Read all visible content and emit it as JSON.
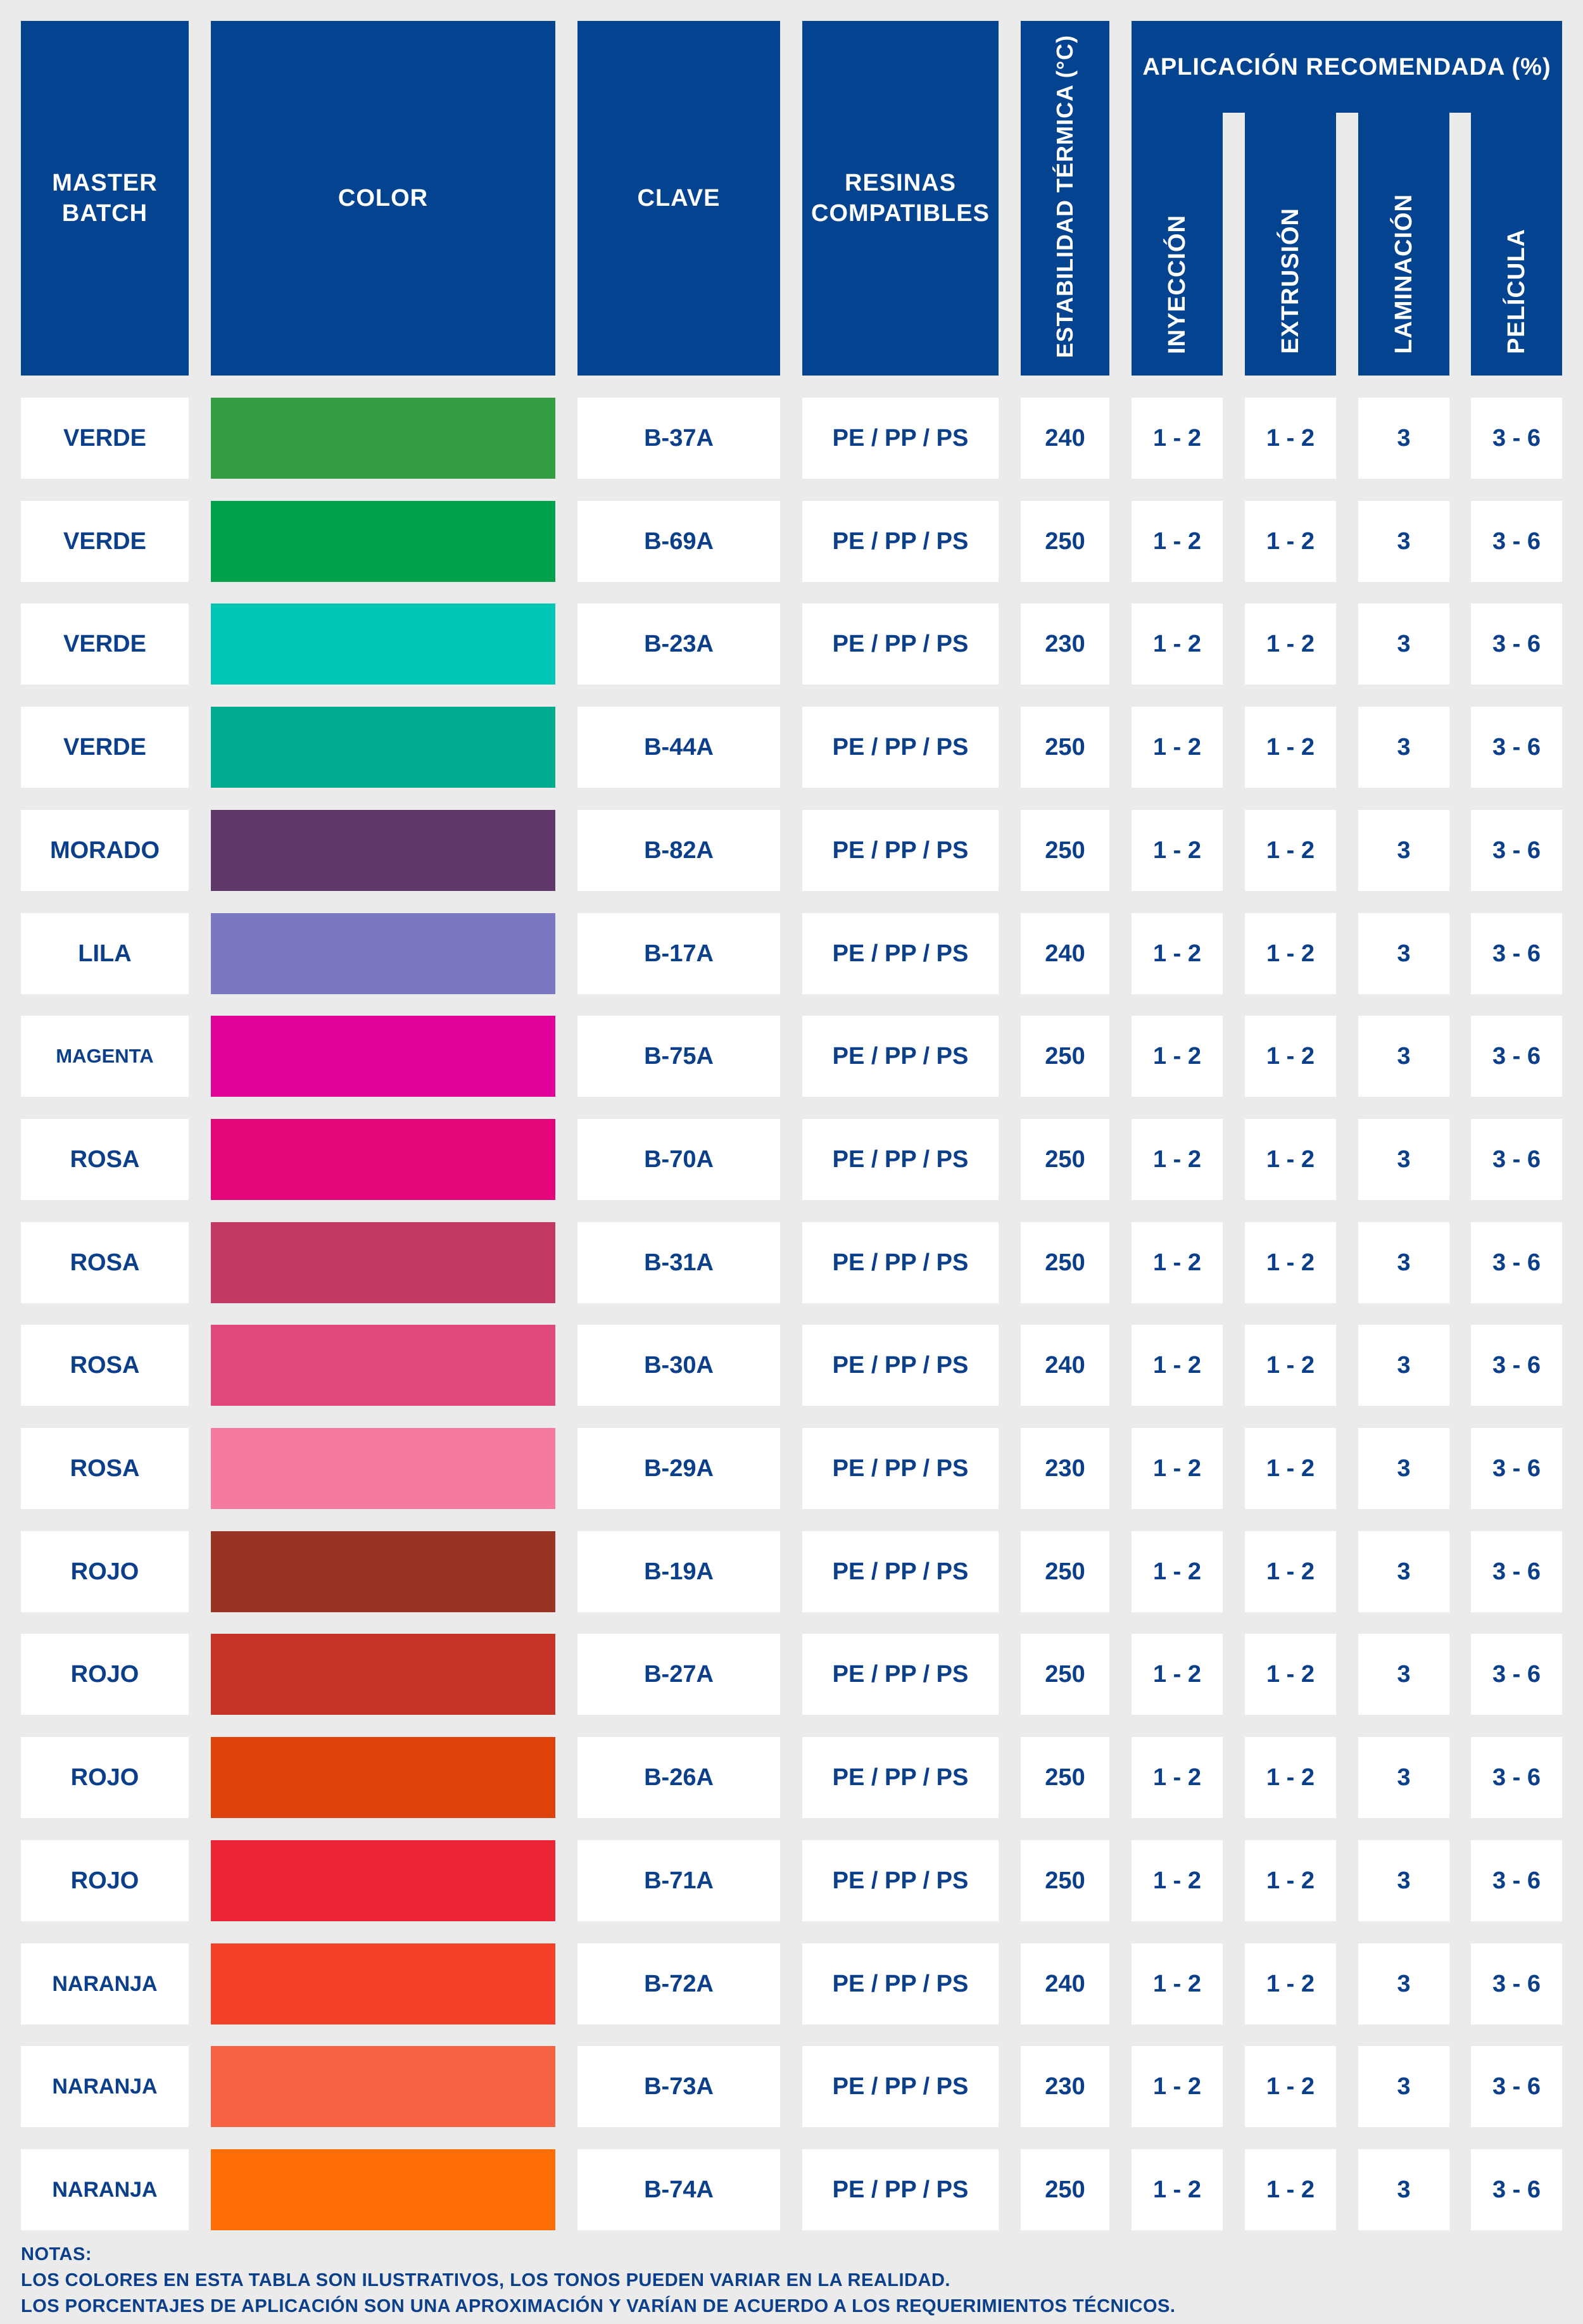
{
  "headers": {
    "master_batch": "MASTER\nBATCH",
    "color": "COLOR",
    "clave": "CLAVE",
    "resinas": "RESINAS\nCOMPATIBLES",
    "estabilidad": "ESTABILIDAD TÉRMICA (°C)",
    "aplicacion": "APLICACIÓN RECOMENDADA (%)",
    "inyeccion": "INYECCIÓN",
    "extrusion": "EXTRUSIÓN",
    "laminacion": "LAMINACIÓN",
    "pelicula": "PELÍCULA"
  },
  "colors": {
    "header_bg": "#03438f",
    "cell_text": "#0b3f8a",
    "page_bg": "#ebebeb"
  },
  "rows": [
    {
      "name": "VERDE",
      "swatch": "#339d41",
      "clave": "B-37A",
      "resinas": "PE / PP / PS",
      "estabilidad": "240",
      "inyeccion": "1 - 2",
      "extrusion": "1 - 2",
      "laminacion": "3",
      "pelicula": "3 - 6"
    },
    {
      "name": "VERDE",
      "swatch": "#00a14c",
      "clave": "B-69A",
      "resinas": "PE / PP / PS",
      "estabilidad": "250",
      "inyeccion": "1 - 2",
      "extrusion": "1 - 2",
      "laminacion": "3",
      "pelicula": "3 - 6"
    },
    {
      "name": "VERDE",
      "swatch": "#00c7b3",
      "clave": "B-23A",
      "resinas": "PE / PP / PS",
      "estabilidad": "230",
      "inyeccion": "1 - 2",
      "extrusion": "1 - 2",
      "laminacion": "3",
      "pelicula": "3 - 6"
    },
    {
      "name": "VERDE",
      "swatch": "#00ab8f",
      "clave": "B-44A",
      "resinas": "PE / PP / PS",
      "estabilidad": "250",
      "inyeccion": "1 - 2",
      "extrusion": "1 - 2",
      "laminacion": "3",
      "pelicula": "3 - 6"
    },
    {
      "name": "MORADO",
      "swatch": "#5f376b",
      "clave": "B-82A",
      "resinas": "PE / PP / PS",
      "estabilidad": "250",
      "inyeccion": "1 - 2",
      "extrusion": "1 - 2",
      "laminacion": "3",
      "pelicula": "3 - 6"
    },
    {
      "name": "LILA",
      "swatch": "#7a78c1",
      "clave": "B-17A",
      "resinas": "PE / PP / PS",
      "estabilidad": "240",
      "inyeccion": "1 - 2",
      "extrusion": "1 - 2",
      "laminacion": "3",
      "pelicula": "3 - 6"
    },
    {
      "name": "MAGENTA",
      "swatch": "#e1029a",
      "clave": "B-75A",
      "resinas": "PE / PP / PS",
      "estabilidad": "250",
      "inyeccion": "1 - 2",
      "extrusion": "1 - 2",
      "laminacion": "3",
      "pelicula": "3 - 6"
    },
    {
      "name": "ROSA",
      "swatch": "#e5057a",
      "clave": "B-70A",
      "resinas": "PE / PP / PS",
      "estabilidad": "250",
      "inyeccion": "1 - 2",
      "extrusion": "1 - 2",
      "laminacion": "3",
      "pelicula": "3 - 6"
    },
    {
      "name": "ROSA",
      "swatch": "#c33763",
      "clave": "B-31A",
      "resinas": "PE / PP / PS",
      "estabilidad": "250",
      "inyeccion": "1 - 2",
      "extrusion": "1 - 2",
      "laminacion": "3",
      "pelicula": "3 - 6"
    },
    {
      "name": "ROSA",
      "swatch": "#e0497e",
      "clave": "B-30A",
      "resinas": "PE / PP / PS",
      "estabilidad": "240",
      "inyeccion": "1 - 2",
      "extrusion": "1 - 2",
      "laminacion": "3",
      "pelicula": "3 - 6"
    },
    {
      "name": "ROSA",
      "swatch": "#f57a9e",
      "clave": "B-29A",
      "resinas": "PE / PP / PS",
      "estabilidad": "230",
      "inyeccion": "1 - 2",
      "extrusion": "1 - 2",
      "laminacion": "3",
      "pelicula": "3 - 6"
    },
    {
      "name": "ROJO",
      "swatch": "#993325",
      "clave": "B-19A",
      "resinas": "PE / PP / PS",
      "estabilidad": "250",
      "inyeccion": "1 - 2",
      "extrusion": "1 - 2",
      "laminacion": "3",
      "pelicula": "3 - 6"
    },
    {
      "name": "ROJO",
      "swatch": "#c53426",
      "clave": "B-27A",
      "resinas": "PE / PP / PS",
      "estabilidad": "250",
      "inyeccion": "1 - 2",
      "extrusion": "1 - 2",
      "laminacion": "3",
      "pelicula": "3 - 6"
    },
    {
      "name": "ROJO",
      "swatch": "#dc420a",
      "clave": "B-26A",
      "resinas": "PE / PP / PS",
      "estabilidad": "250",
      "inyeccion": "1 - 2",
      "extrusion": "1 - 2",
      "laminacion": "3",
      "pelicula": "3 - 6"
    },
    {
      "name": "ROJO",
      "swatch": "#ec2636",
      "clave": "B-71A",
      "resinas": "PE / PP / PS",
      "estabilidad": "250",
      "inyeccion": "1 - 2",
      "extrusion": "1 - 2",
      "laminacion": "3",
      "pelicula": "3 - 6"
    },
    {
      "name": "NARANJA",
      "swatch": "#f34028",
      "clave": "B-72A",
      "resinas": "PE / PP / PS",
      "estabilidad": "240",
      "inyeccion": "1 - 2",
      "extrusion": "1 - 2",
      "laminacion": "3",
      "pelicula": "3 - 6"
    },
    {
      "name": "NARANJA",
      "swatch": "#f66342",
      "clave": "B-73A",
      "resinas": "PE / PP / PS",
      "estabilidad": "230",
      "inyeccion": "1 - 2",
      "extrusion": "1 - 2",
      "laminacion": "3",
      "pelicula": "3 - 6"
    },
    {
      "name": "NARANJA",
      "swatch": "#ff6d05",
      "clave": "B-74A",
      "resinas": "PE / PP / PS",
      "estabilidad": "250",
      "inyeccion": "1 - 2",
      "extrusion": "1 - 2",
      "laminacion": "3",
      "pelicula": "3 - 6"
    }
  ],
  "notes": {
    "title": "NOTAS:",
    "line1": "LOS COLORES EN ESTA TABLA SON ILUSTRATIVOS, LOS TONOS PUEDEN VARIAR EN LA REALIDAD.",
    "line2": "LOS PORCENTAJES DE APLICACIÓN SON UNA APROXIMACIÓN Y VARÍAN DE ACUERDO A LOS REQUERIMIENTOS TÉCNICOS."
  }
}
